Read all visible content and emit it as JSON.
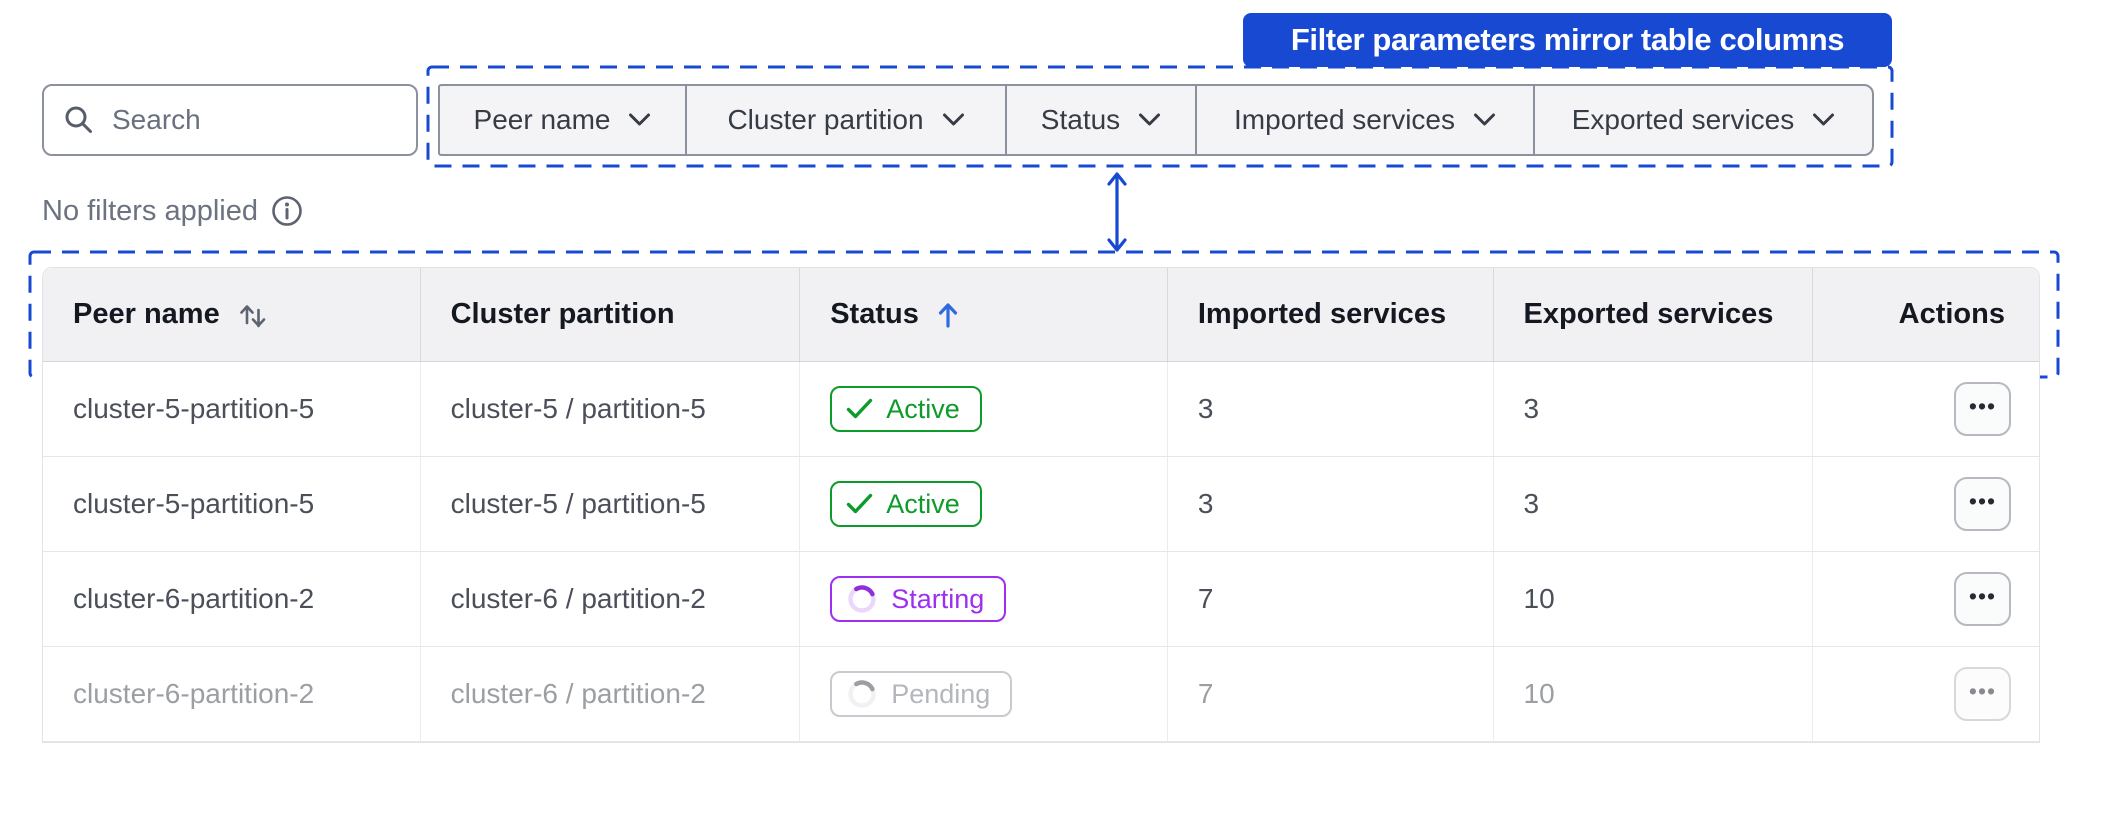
{
  "annotation": {
    "banner_label": "Filter parameters mirror table columns"
  },
  "search": {
    "placeholder": "Search"
  },
  "filter_bar": {
    "items": [
      {
        "label": "Peer name"
      },
      {
        "label": "Cluster partition"
      },
      {
        "label": "Status"
      },
      {
        "label": "Imported services"
      },
      {
        "label": "Exported services"
      }
    ]
  },
  "filters_status": {
    "text": "No filters applied"
  },
  "table": {
    "columns": [
      {
        "label": "Peer name",
        "sort": "sortable-both"
      },
      {
        "label": "Cluster partition",
        "sort": "none"
      },
      {
        "label": "Status",
        "sort": "ascending"
      },
      {
        "label": "Imported services",
        "sort": "none"
      },
      {
        "label": "Exported services",
        "sort": "none"
      },
      {
        "label": "Actions",
        "sort": "none"
      }
    ],
    "rows": [
      {
        "peer_name": "cluster-5-partition-5",
        "cluster_partition": "cluster-5 / partition-5",
        "status": "Active",
        "imported_services": "3",
        "exported_services": "3"
      },
      {
        "peer_name": "cluster-5-partition-5",
        "cluster_partition": "cluster-5 / partition-5",
        "status": "Active",
        "imported_services": "3",
        "exported_services": "3"
      },
      {
        "peer_name": "cluster-6-partition-2",
        "cluster_partition": "cluster-6 / partition-2",
        "status": "Starting",
        "imported_services": "7",
        "exported_services": "10"
      },
      {
        "peer_name": "cluster-6-partition-2",
        "cluster_partition": "cluster-6 / partition-2",
        "status": "Pending",
        "imported_services": "7",
        "exported_services": "10"
      }
    ],
    "actions_button_glyph": "•••"
  },
  "colors": {
    "annotation_blue": "#1849d2",
    "sort_active_blue": "#2f6ae0",
    "status_active_green": "#0e9b2c",
    "status_starting_purple": "#9d2ef2",
    "status_pending_gray": "#9aa0a8"
  }
}
